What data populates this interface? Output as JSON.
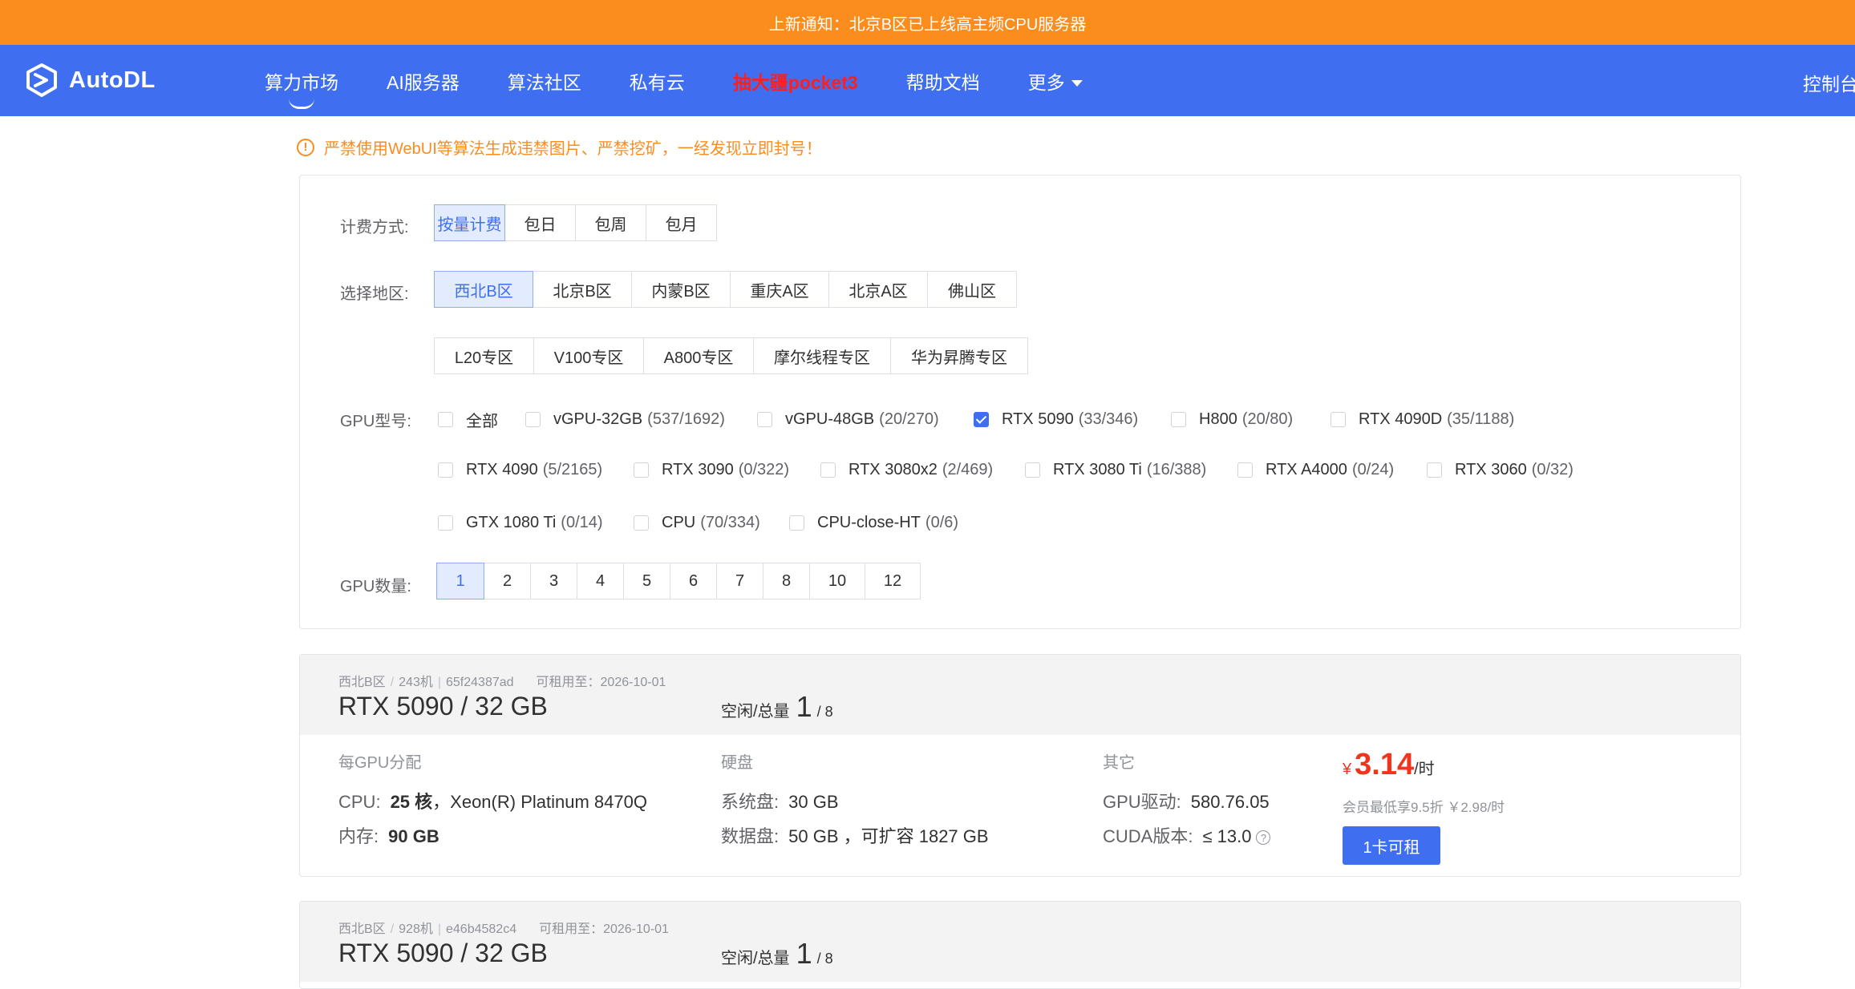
{
  "notice": "上新通知：北京B区已上线高主频CPU服务器",
  "brand": {
    "name": "AutoDL",
    "logo_icon": "autodl-logo-icon"
  },
  "nav": {
    "items": [
      "算力市场",
      "AI服务器",
      "算法社区",
      "私有云",
      "抽大疆pocket3",
      "帮助文档",
      "更多"
    ],
    "console": "控制台"
  },
  "warning": {
    "icon": "!",
    "text": "严禁使用WebUI等算法生成违禁图片、严禁挖矿，一经发现立即封号！"
  },
  "filters": {
    "billing": {
      "label": "计费方式:",
      "options": [
        "按量计费",
        "包日",
        "包周",
        "包月"
      ],
      "selected": "按量计费"
    },
    "region": {
      "label": "选择地区:",
      "row1": [
        "西北B区",
        "北京B区",
        "内蒙B区",
        "重庆A区",
        "北京A区",
        "佛山区"
      ],
      "row2": [
        "L20专区",
        "V100专区",
        "A800专区",
        "摩尔线程专区",
        "华为昇腾专区"
      ],
      "selected": "西北B区"
    },
    "gpu": {
      "label": "GPU型号:",
      "row1": [
        {
          "name": "全部",
          "count": "",
          "checked": false
        },
        {
          "name": "vGPU-32GB",
          "count": "(537/1692)",
          "checked": false
        },
        {
          "name": "vGPU-48GB",
          "count": "(20/270)",
          "checked": false
        },
        {
          "name": "RTX 5090",
          "count": "(33/346)",
          "checked": true
        },
        {
          "name": "H800",
          "count": "(20/80)",
          "checked": false
        },
        {
          "name": "RTX 4090D",
          "count": "(35/1188)",
          "checked": false
        }
      ],
      "row2": [
        {
          "name": "RTX 4090",
          "count": "(5/2165)",
          "checked": false
        },
        {
          "name": "RTX 3090",
          "count": "(0/322)",
          "checked": false
        },
        {
          "name": "RTX 3080x2",
          "count": "(2/469)",
          "checked": false
        },
        {
          "name": "RTX 3080 Ti",
          "count": "(16/388)",
          "checked": false
        },
        {
          "name": "RTX A4000",
          "count": "(0/24)",
          "checked": false
        },
        {
          "name": "RTX 3060",
          "count": "(0/32)",
          "checked": false
        }
      ],
      "row3": [
        {
          "name": "GTX 1080 Ti",
          "count": "(0/14)",
          "checked": false
        },
        {
          "name": "CPU",
          "count": "(70/334)",
          "checked": false
        },
        {
          "name": "CPU-close-HT",
          "count": "(0/6)",
          "checked": false
        }
      ]
    },
    "gpu_count": {
      "label": "GPU数量:",
      "options": [
        "1",
        "2",
        "3",
        "4",
        "5",
        "6",
        "7",
        "8",
        "10",
        "12"
      ],
      "selected": "1"
    }
  },
  "machines": [
    {
      "region": "西北B区",
      "machine_no": "243机",
      "id": "65f24387ad",
      "rent_until": "可租用至：2026-10-01",
      "title": "RTX 5090 / 32 GB",
      "avail_label": "空闲/总量",
      "free": "1",
      "total": "/ 8",
      "headers": {
        "per_gpu": "每GPU分配",
        "disk": "硬盘",
        "other": "其它"
      },
      "cpu_label": "CPU:",
      "cpu_cores": "25 核",
      "cpu_model": "，Xeon(R) Platinum 8470Q",
      "mem_label": "内存:",
      "mem": "90 GB",
      "sys_disk_label": "系统盘:",
      "sys_disk": "30 GB",
      "data_disk_label": "数据盘:",
      "data_disk": "50 GB ，可扩容 1827 GB",
      "driver_label": "GPU驱动:",
      "driver": "580.76.05",
      "cuda_label": "CUDA版本:",
      "cuda": "≤ 13.0",
      "price_currency": "¥",
      "price": "3.14",
      "price_unit": "/时",
      "member_price": "会员最低享9.5折 ￥2.98/时",
      "rent_button": "1卡可租"
    },
    {
      "region": "西北B区",
      "machine_no": "928机",
      "id": "e46b4582c4",
      "rent_until": "可租用至：2026-10-01",
      "title": "RTX 5090 / 32 GB",
      "avail_label": "空闲/总量",
      "free": "1",
      "total": "/ 8"
    }
  ]
}
